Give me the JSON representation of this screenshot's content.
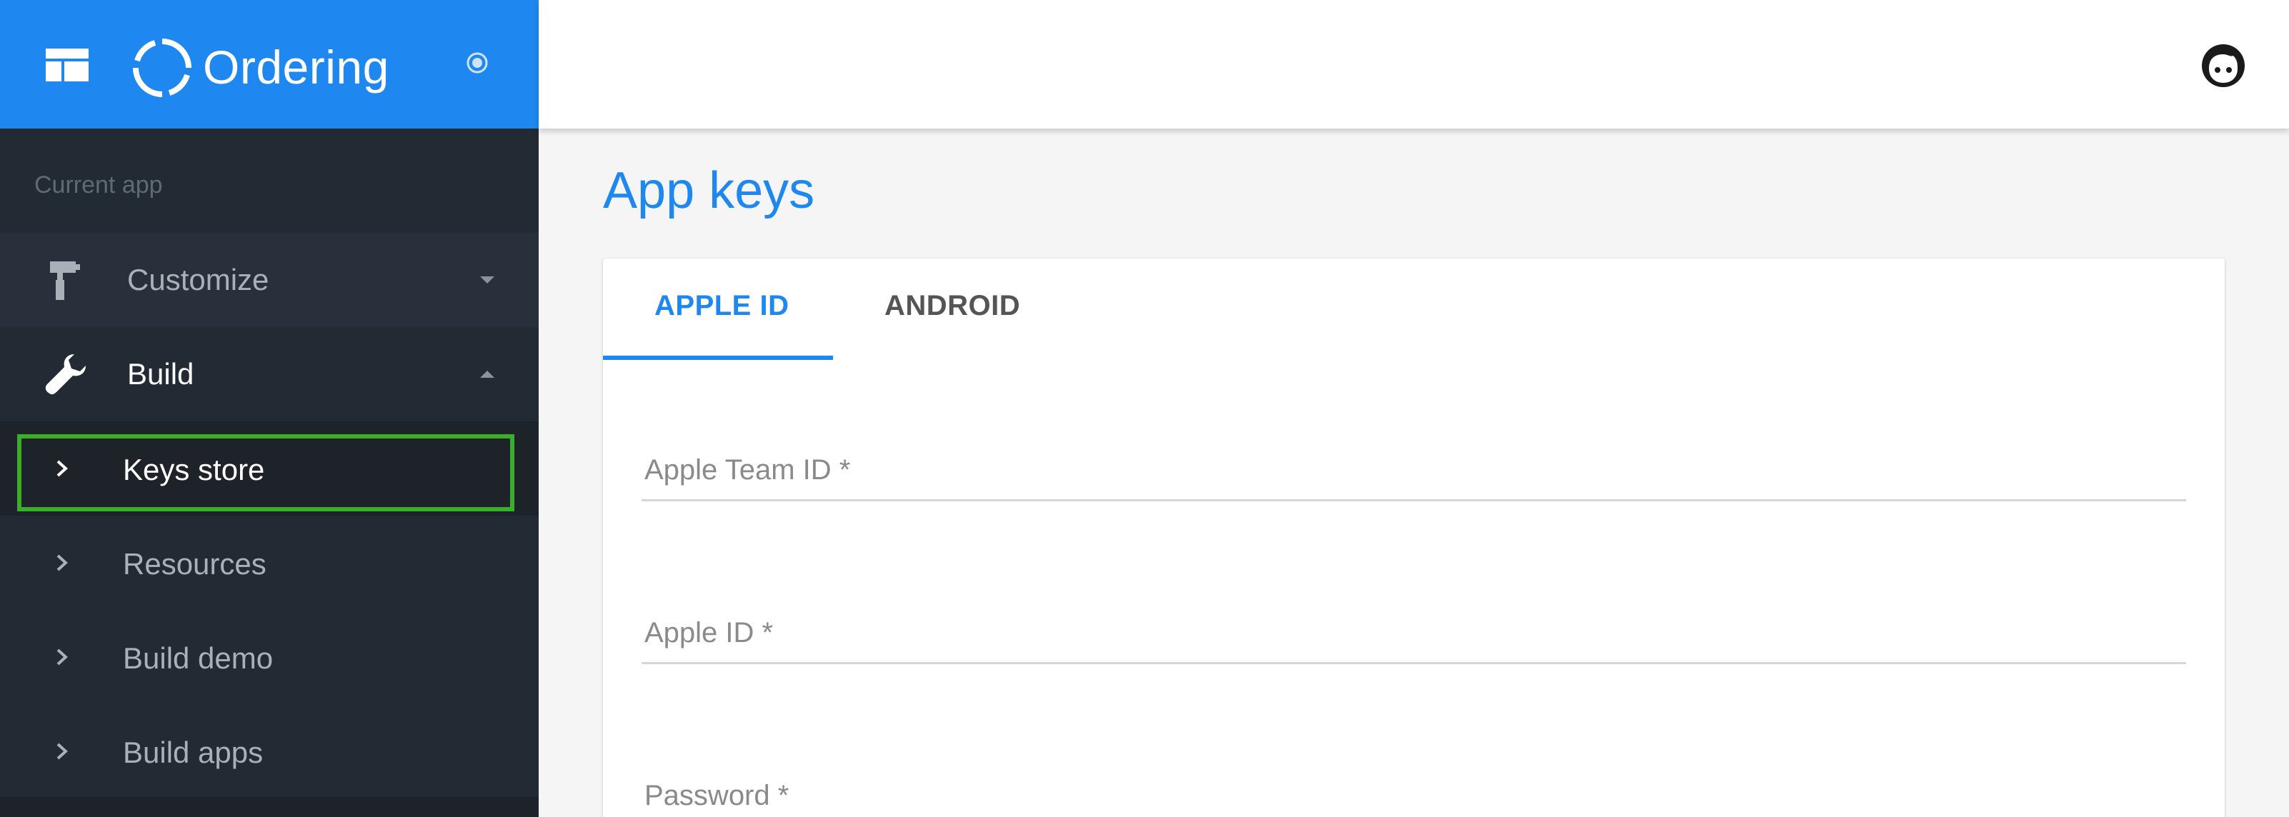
{
  "app": {
    "name": "Ordering"
  },
  "sidebar": {
    "section_label": "Current app",
    "items": [
      {
        "label": "Customize",
        "icon": "paint-roller-icon",
        "expanded": false
      },
      {
        "label": "Build",
        "icon": "wrench-icon",
        "expanded": true
      }
    ],
    "build_children": [
      {
        "label": "Keys store",
        "selected": true
      },
      {
        "label": "Resources"
      },
      {
        "label": "Build demo"
      },
      {
        "label": "Build apps"
      }
    ]
  },
  "main": {
    "title": "App keys",
    "tabs": [
      {
        "label": "APPLE ID",
        "active": true
      },
      {
        "label": "ANDROID",
        "active": false
      }
    ],
    "fields": [
      {
        "label": "Apple Team ID *"
      },
      {
        "label": "Apple ID *"
      },
      {
        "label": "Password *"
      }
    ]
  },
  "colors": {
    "primary": "#1e88f0",
    "sidebar_bg": "#222a33",
    "highlight": "#3aae2a"
  }
}
